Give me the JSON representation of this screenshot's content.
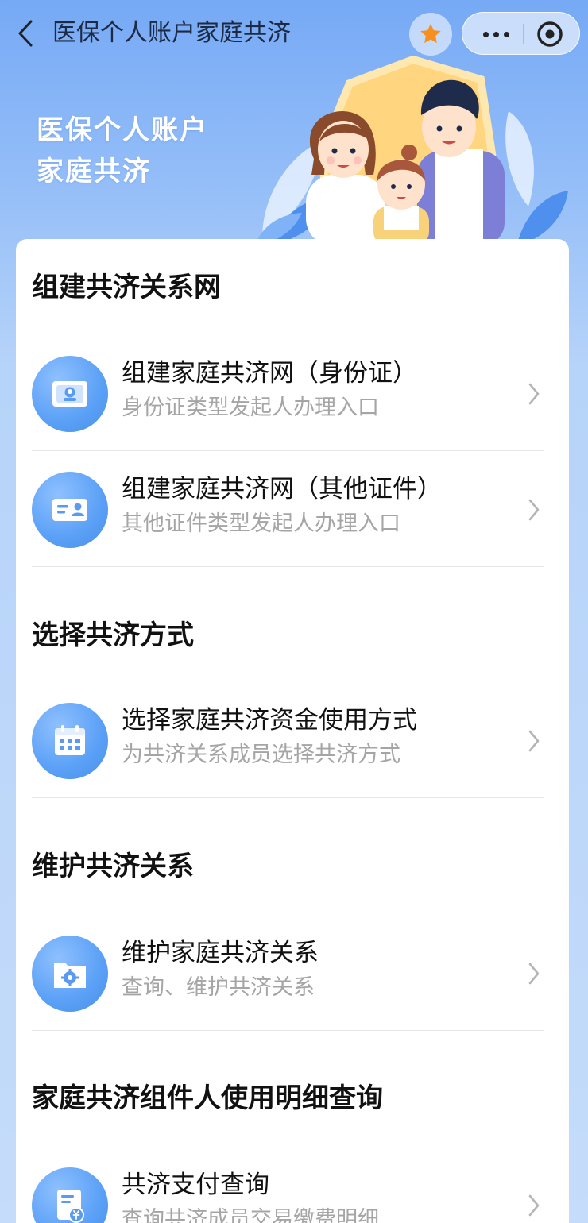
{
  "header": {
    "title": "医保个人账户家庭共济"
  },
  "banner": {
    "line1": "医保个人账户",
    "line2": "家庭共济"
  },
  "sections": [
    {
      "title": "组建共济关系网",
      "items": [
        {
          "label": "组建家庭共济网（身份证）",
          "sub": "身份证类型发起人办理入口",
          "icon": "id-card-icon"
        },
        {
          "label": "组建家庭共济网（其他证件）",
          "sub": "其他证件类型发起人办理入口",
          "icon": "contact-card-icon"
        }
      ]
    },
    {
      "title": "选择共济方式",
      "items": [
        {
          "label": "选择家庭共济资金使用方式",
          "sub": "为共济关系成员选择共济方式",
          "icon": "calendar-icon"
        }
      ]
    },
    {
      "title": "维护共济关系",
      "items": [
        {
          "label": "维护家庭共济关系",
          "sub": "查询、维护共济关系",
          "icon": "settings-folder-icon"
        }
      ]
    },
    {
      "title": "家庭共济组件人使用明细查询",
      "items": [
        {
          "label": "共济支付查询",
          "sub": "查询共济成员交易缴费明细",
          "icon": "payment-document-icon"
        }
      ]
    }
  ],
  "colors": {
    "accent": "#5aa0f6",
    "favorite": "#f5901e",
    "background_top": "#76a9f5"
  }
}
